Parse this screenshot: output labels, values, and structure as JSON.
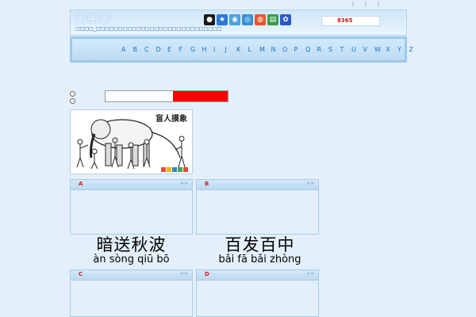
{
  "header": {
    "logo_text": "□□□",
    "tagline": "□□□□_□□□□□□□□□□□□□□□□□□□□□□□□□□□□",
    "top_links": "| | |",
    "search_value": "8365"
  },
  "icons": [
    {
      "name": "qq-icon",
      "glyph": "●",
      "color": "#1a1a1a"
    },
    {
      "name": "star-icon",
      "glyph": "★",
      "color": "#2d7ad6"
    },
    {
      "name": "share-icon",
      "glyph": "◉",
      "color": "#4aa0e0"
    },
    {
      "name": "circle-icon",
      "glyph": "◎",
      "color": "#3a8fd6"
    },
    {
      "name": "weibo-icon",
      "glyph": "◍",
      "color": "#e5562b"
    },
    {
      "name": "book-icon",
      "glyph": "▤",
      "color": "#3a9b4a"
    },
    {
      "name": "baidu-icon",
      "glyph": "✿",
      "color": "#2b58c8"
    }
  ],
  "alphabet": [
    "A",
    "B",
    "C",
    "D",
    "E",
    "F",
    "G",
    "H",
    "I",
    "J",
    "K",
    "L",
    "M",
    "N",
    "O",
    "P",
    "Q",
    "R",
    "S",
    "T",
    "U",
    "V",
    "W",
    "X",
    "Y",
    "Z"
  ],
  "progress": {
    "fraction": 0.45
  },
  "featured_image": {
    "title": "盲人摸象"
  },
  "panels": [
    {
      "title": "A",
      "more": ">>"
    },
    {
      "title": "B",
      "more": ">>"
    },
    {
      "title": "C",
      "more": ">>"
    },
    {
      "title": "D",
      "more": ">>"
    }
  ],
  "idioms": [
    {
      "hanzi": "暗送秋波",
      "pinyin": "àn sòng qiū bō"
    },
    {
      "hanzi": "百发百中",
      "pinyin": "bǎi fā bǎi zhòng"
    }
  ],
  "colors": {
    "accent": "#1e6fb8",
    "highlight": "#ff0000"
  }
}
